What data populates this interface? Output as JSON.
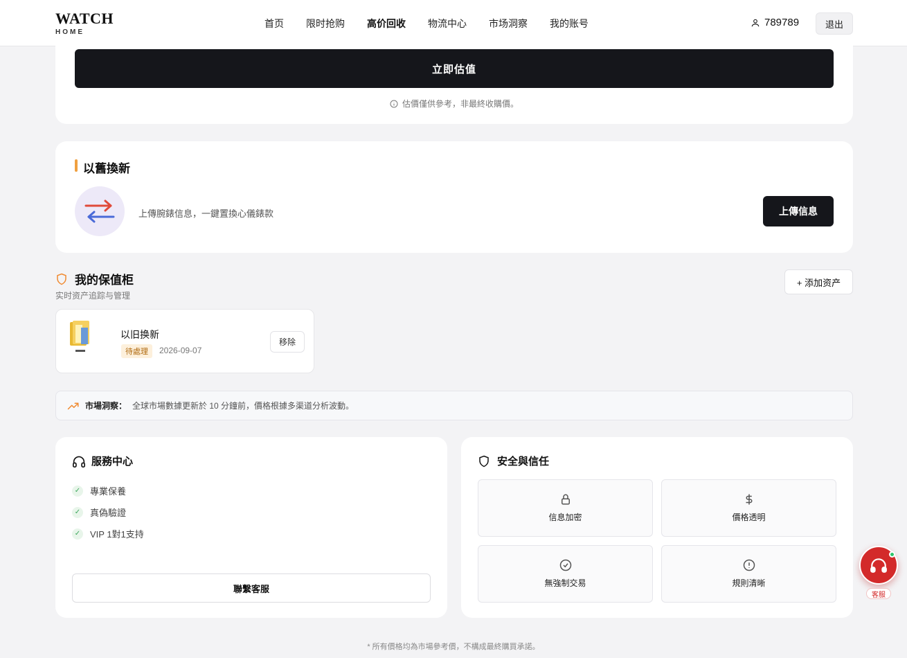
{
  "header": {
    "logo_main": "WATCH",
    "logo_sub": "HOME",
    "nav": [
      "首页",
      "限时抢购",
      "高价回收",
      "物流中心",
      "市场洞察",
      "我的账号"
    ],
    "active_nav": "高价回收",
    "username": "789789",
    "logout_label": "退出"
  },
  "estimate": {
    "button_label": "立即估值",
    "disclaimer": "估價僅供參考，非最終收購價。"
  },
  "trade_in": {
    "title": "以舊換新",
    "description": "上傳腕錶信息，一鍵置換心儀錶款",
    "upload_label": "上傳信息"
  },
  "vault": {
    "title": "我的保值柜",
    "subtitle": "实时资产追踪与管理",
    "add_label": "+ 添加资产",
    "items": [
      {
        "name": "以旧换新",
        "status": "待處理",
        "date": "2026-09-07",
        "remove_label": "移除"
      }
    ]
  },
  "market": {
    "label": "市場洞察：",
    "text": "全球市場數據更新於 10 分鐘前，價格根據多渠道分析波動。"
  },
  "service": {
    "title": "服務中心",
    "items": [
      "專業保養",
      "真偽驗證",
      "VIP 1對1支持"
    ],
    "contact_label": "聯繫客服"
  },
  "security": {
    "title": "安全與信任",
    "tiles": [
      {
        "label": "信息加密",
        "icon": "lock-icon"
      },
      {
        "label": "價格透明",
        "icon": "dollar-icon"
      },
      {
        "label": "無強制交易",
        "icon": "check-circle-icon"
      },
      {
        "label": "規則清晰",
        "icon": "alert-circle-icon"
      }
    ]
  },
  "footer_note": "* 所有價格均為市場參考價，不構成最終購買承諾。",
  "support_fab": {
    "label": "客服"
  },
  "colors": {
    "accent_bar": "#f0a040",
    "primary_button": "#15161b",
    "fab": "#d32a2a"
  }
}
